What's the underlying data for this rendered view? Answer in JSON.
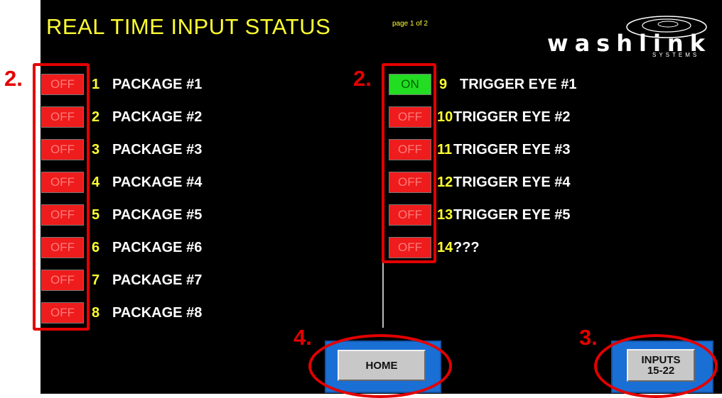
{
  "title": "REAL TIME INPUT STATUS",
  "page_indicator": "page 1 of 2",
  "logo": {
    "word": "washlink",
    "subtitle": "SYSTEMS"
  },
  "left_inputs": [
    {
      "status": "OFF",
      "num": "1",
      "name": "PACKAGE #1"
    },
    {
      "status": "OFF",
      "num": "2",
      "name": "PACKAGE #2"
    },
    {
      "status": "OFF",
      "num": "3",
      "name": "PACKAGE #3"
    },
    {
      "status": "OFF",
      "num": "4",
      "name": "PACKAGE #4"
    },
    {
      "status": "OFF",
      "num": "5",
      "name": "PACKAGE #5"
    },
    {
      "status": "OFF",
      "num": "6",
      "name": "PACKAGE #6"
    },
    {
      "status": "OFF",
      "num": "7",
      "name": "PACKAGE #7"
    },
    {
      "status": "OFF",
      "num": "8",
      "name": "PACKAGE #8"
    }
  ],
  "right_inputs": [
    {
      "status": "ON",
      "num": "9",
      "name": "TRIGGER EYE #1"
    },
    {
      "status": "OFF",
      "num": "10",
      "name": "TRIGGER EYE #2"
    },
    {
      "status": "OFF",
      "num": "11",
      "name": "TRIGGER EYE #3"
    },
    {
      "status": "OFF",
      "num": "12",
      "name": "TRIGGER EYE #4"
    },
    {
      "status": "OFF",
      "num": "13",
      "name": "TRIGGER EYE #5"
    },
    {
      "status": "OFF",
      "num": "14",
      "name": "???"
    }
  ],
  "buttons": {
    "home": "HOME",
    "inputs_line1": "INPUTS",
    "inputs_line2": "15-22"
  },
  "annotations": {
    "a_left": "2.",
    "a_right": "2.",
    "a_inputs": "3.",
    "a_home": "4."
  },
  "colors": {
    "off": "#ee1c1c",
    "on": "#22dd22",
    "title": "#ffff33",
    "annotation": "#e30000"
  }
}
